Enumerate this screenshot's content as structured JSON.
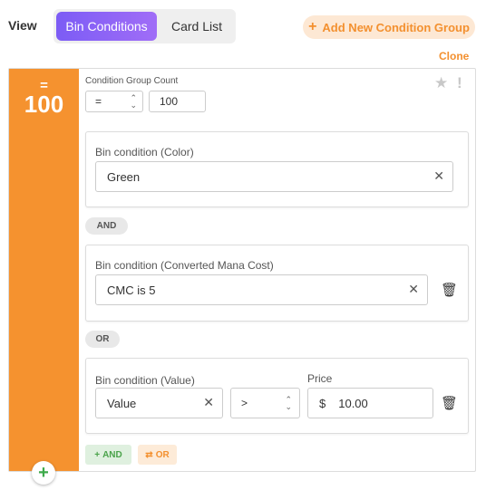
{
  "header": {
    "view_label": "View",
    "tabs": [
      {
        "label": "Bin Conditions",
        "active": true
      },
      {
        "label": "Card List",
        "active": false
      }
    ],
    "add_group_label": "Add New Condition Group",
    "clone_label": "Clone"
  },
  "group": {
    "operator": "=",
    "count": "100",
    "count_label": "Condition Group Count",
    "operator_select_value": "=",
    "count_input_value": "100",
    "conditions": [
      {
        "label": "Bin condition (Color)",
        "value": "Green"
      },
      {
        "label": "Bin condition (Converted Mana Cost)",
        "value": "CMC is 5"
      },
      {
        "label": "Bin condition (Value)",
        "value": "Value",
        "comparator": ">",
        "price_label": "Price",
        "currency": "$",
        "price": "10.00"
      }
    ],
    "connectors": [
      "AND",
      "OR"
    ],
    "add_and_label": "AND",
    "add_or_label": "OR"
  },
  "colors": {
    "accent_orange": "#f5922f",
    "accent_purple": "#7c5cf5",
    "green": "#3daa4a"
  },
  "icons": [
    "plus-icon",
    "star-icon",
    "alert-icon",
    "clear-icon",
    "trash-icon",
    "chevron-updown-icon",
    "swap-icon"
  ]
}
